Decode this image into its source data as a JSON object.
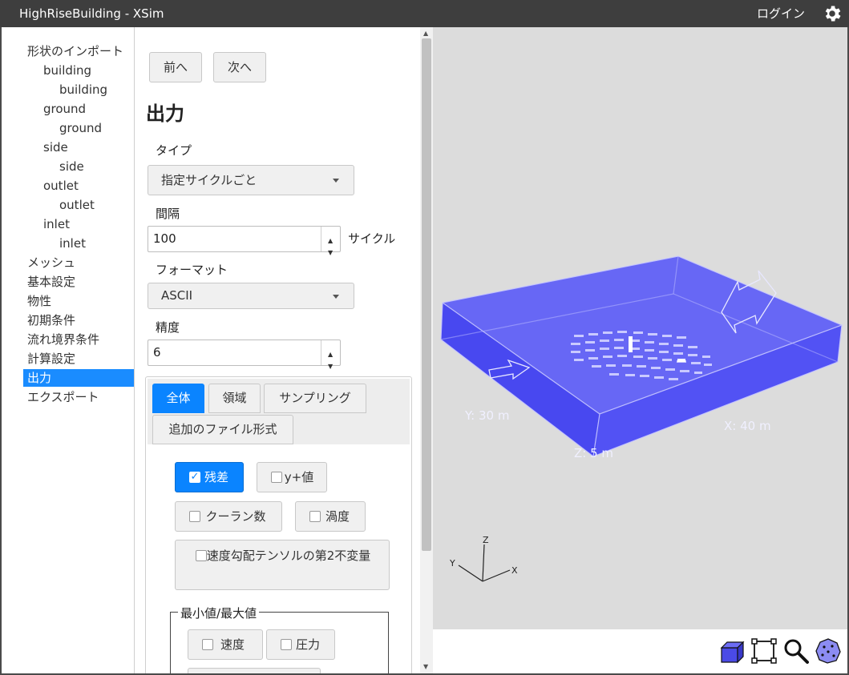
{
  "titlebar": {
    "title": "HighRiseBuilding - XSim",
    "login": "ログイン"
  },
  "tree": [
    {
      "label": "形状のインポート",
      "level": 0
    },
    {
      "label": "building",
      "level": 1
    },
    {
      "label": "building",
      "level": 2
    },
    {
      "label": "ground",
      "level": 1
    },
    {
      "label": "ground",
      "level": 2
    },
    {
      "label": "side",
      "level": 1
    },
    {
      "label": "side",
      "level": 2
    },
    {
      "label": "outlet",
      "level": 1
    },
    {
      "label": "outlet",
      "level": 2
    },
    {
      "label": "inlet",
      "level": 1
    },
    {
      "label": "inlet",
      "level": 2
    },
    {
      "label": "メッシュ",
      "level": 0
    },
    {
      "label": "基本設定",
      "level": 0
    },
    {
      "label": "物性",
      "level": 0
    },
    {
      "label": "初期条件",
      "level": 0
    },
    {
      "label": "流れ境界条件",
      "level": 0
    },
    {
      "label": "計算設定",
      "level": 0
    },
    {
      "label": "出力",
      "level": 0,
      "active": true
    },
    {
      "label": "エクスポート",
      "level": 0
    }
  ],
  "panel": {
    "prev": "前へ",
    "next": "次へ",
    "heading": "出力",
    "type_label": "タイプ",
    "type_value": "指定サイクルごと",
    "interval_label": "間隔",
    "interval_value": "100",
    "interval_unit": "サイクル",
    "format_label": "フォーマット",
    "format_value": "ASCII",
    "precision_label": "精度",
    "precision_value": "6",
    "tabs": [
      "全体",
      "領域",
      "サンプリング",
      "追加のファイル形式"
    ],
    "checks": {
      "residual": {
        "label": "残差",
        "checked": true
      },
      "yplus": {
        "label": "y+値",
        "checked": false
      },
      "courant": {
        "label": "クーラン数",
        "checked": false
      },
      "vorticity": {
        "label": "渦度",
        "checked": false
      },
      "q_criterion": {
        "label": "速度勾配テンソルの第2不変量",
        "checked": false
      }
    },
    "minmax_legend": "最小値/最大値",
    "minmax": {
      "velocity": {
        "label": "速度",
        "checked": false
      },
      "pressure": {
        "label": "圧力",
        "checked": false
      }
    }
  },
  "viewport": {
    "label_y": "Y: 30 m",
    "label_x": "X: 40 m",
    "label_z": "Z: 5 m",
    "axis_z": "Z",
    "axis_y": "Y",
    "axis_x": "X",
    "box_color": "#5555ff"
  },
  "toolbar3d": [
    "cube-view-icon",
    "fit-box-icon",
    "zoom-icon",
    "point-cloud-icon"
  ]
}
